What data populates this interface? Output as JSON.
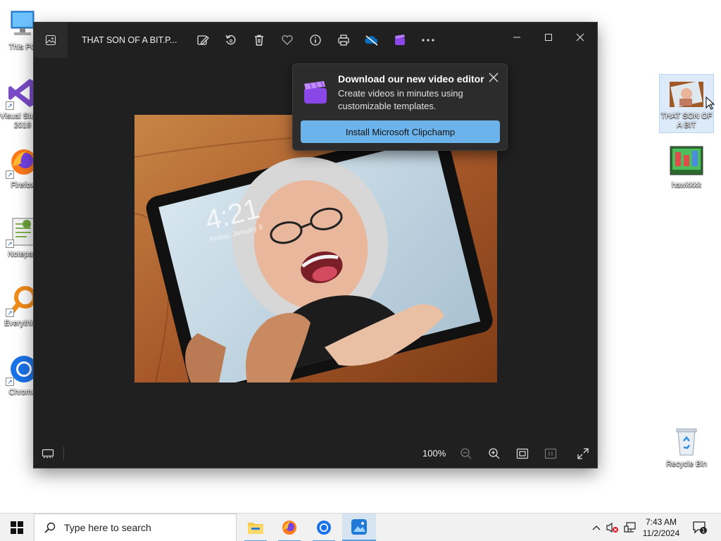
{
  "desktop": {
    "icons_left": [
      {
        "label": "This PC",
        "icon": "computer-icon"
      },
      {
        "label": "Visual Studio 2019",
        "icon": "visual-studio-icon"
      },
      {
        "label": "Firefox",
        "icon": "firefox-icon"
      },
      {
        "label": "Notepad",
        "icon": "notepad-icon"
      },
      {
        "label": "Everything",
        "icon": "everything-search-icon"
      },
      {
        "label": "Chrome",
        "icon": "chrome-icon"
      }
    ],
    "icons_right": [
      {
        "label": "THAT SON OF A BIT",
        "icon": "photo-thumbnail-icon"
      },
      {
        "label": "hawkkkk",
        "icon": "game-thumbnail-icon"
      },
      {
        "label": "Recycle Bin",
        "icon": "recycle-bin-icon"
      }
    ]
  },
  "window": {
    "title": "THAT SON OF A BIT.P...",
    "toolbar": [
      "edit-image-icon",
      "rotate-icon",
      "delete-icon",
      "favorite-icon",
      "info-icon",
      "print-icon",
      "onedrive-icon",
      "clipchamp-icon",
      "more-icon"
    ],
    "controls": [
      "minimize-icon",
      "maximize-icon",
      "close-icon"
    ],
    "zoom_label": "100%",
    "photo_clock": "4:21",
    "photo_date": "Friday, January 8"
  },
  "popup": {
    "title": "Download our new video editor",
    "description": "Create videos in minutes using customizable templates.",
    "button_label": "Install Microsoft Clipchamp"
  },
  "taskbar": {
    "search_placeholder": "Type here to search",
    "apps": [
      "file-explorer-icon",
      "firefox-icon",
      "chrome-icon",
      "photos-icon"
    ],
    "time": "7:43 AM",
    "date": "11/2/2024",
    "notification_count": "1"
  },
  "colors": {
    "window_bg": "#202020",
    "popup_button": "#6bb3ea",
    "taskbar_bg": "#f1f1f1"
  }
}
